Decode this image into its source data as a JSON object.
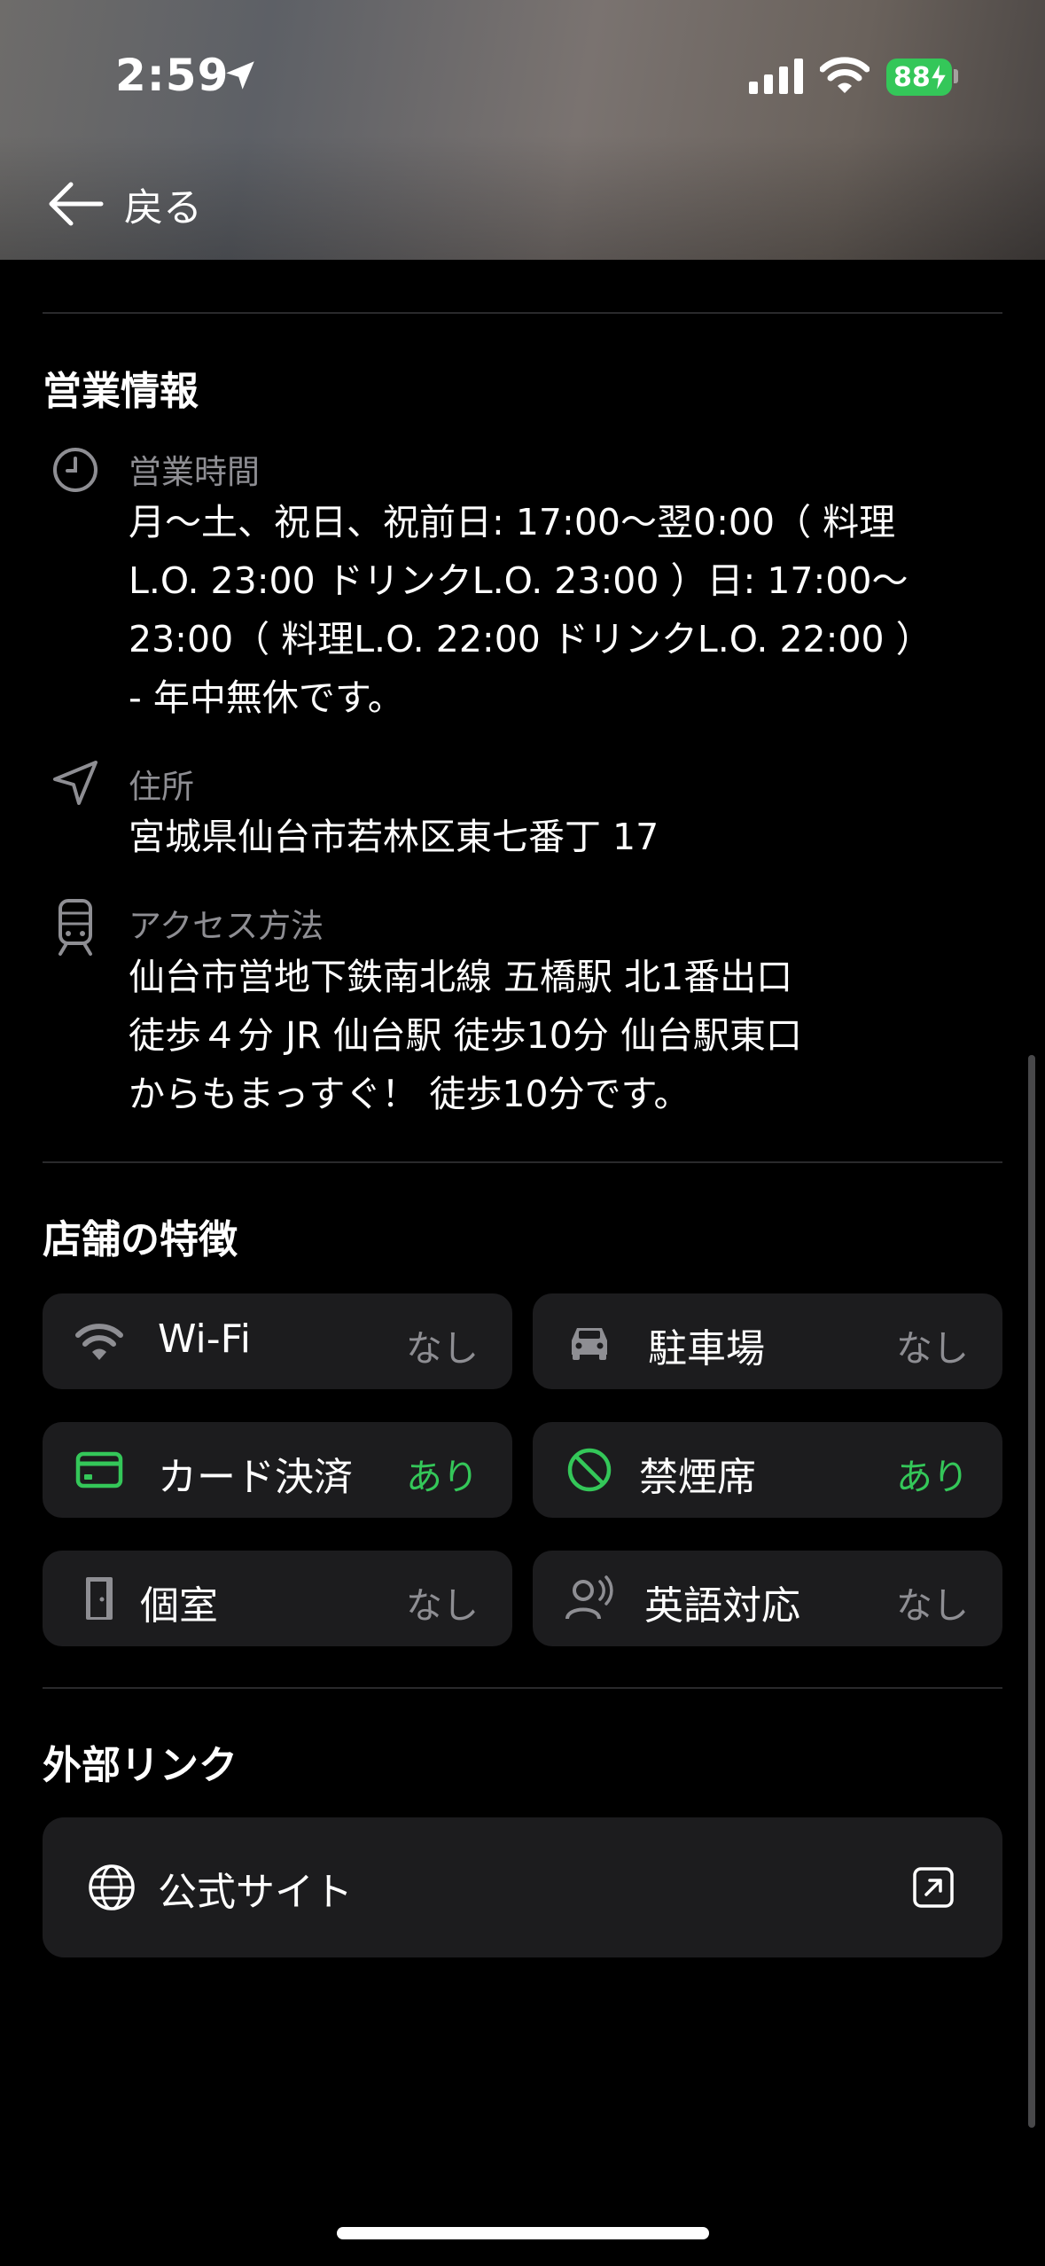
{
  "status_bar": {
    "time": "2:59",
    "battery": "88"
  },
  "nav": {
    "back_label": "戻る"
  },
  "business_info": {
    "title": "営業情報",
    "hours": {
      "label": "営業時間",
      "lines": [
        "月～土、祝日、祝前日: 17:00～翌0:00（ 料理",
        "L.O. 23:00 ドリンクL.O. 23:00 ）日: 17:00～",
        "23:00（ 料理L.O. 22:00 ドリンクL.O. 22:00 ）",
        "- 年中無休です。"
      ]
    },
    "address": {
      "label": "住所",
      "value": "宮城県仙台市若林区東七番丁 17"
    },
    "access": {
      "label": "アクセス方法",
      "lines": [
        "仙台市営地下鉄南北線 五橋駅 北1番出口",
        "徒歩４分 JR 仙台駅 徒歩10分 仙台駅東口",
        "からもまっすぐ！ 徒歩10分です。"
      ]
    }
  },
  "features": {
    "title": "店舗の特徴",
    "items": [
      {
        "label": "Wi-Fi",
        "value": "なし",
        "icon": "wifi-icon",
        "available": false
      },
      {
        "label": "駐車場",
        "value": "なし",
        "icon": "car-icon",
        "available": false
      },
      {
        "label": "カード決済",
        "value": "あり",
        "icon": "credit-card-icon",
        "available": true
      },
      {
        "label": "禁煙席",
        "value": "あり",
        "icon": "no-smoking-icon",
        "available": true
      },
      {
        "label": "個室",
        "value": "なし",
        "icon": "door-icon",
        "available": false
      },
      {
        "label": "英語対応",
        "value": "なし",
        "icon": "speaking-person-icon",
        "available": false
      }
    ]
  },
  "external_links": {
    "title": "外部リンク",
    "items": [
      {
        "label": "公式サイト",
        "icon": "globe-icon"
      }
    ]
  },
  "colors": {
    "accent_green": "#34c759",
    "secondary_text": "#8e8e93",
    "card_bg": "#1c1c1e"
  }
}
